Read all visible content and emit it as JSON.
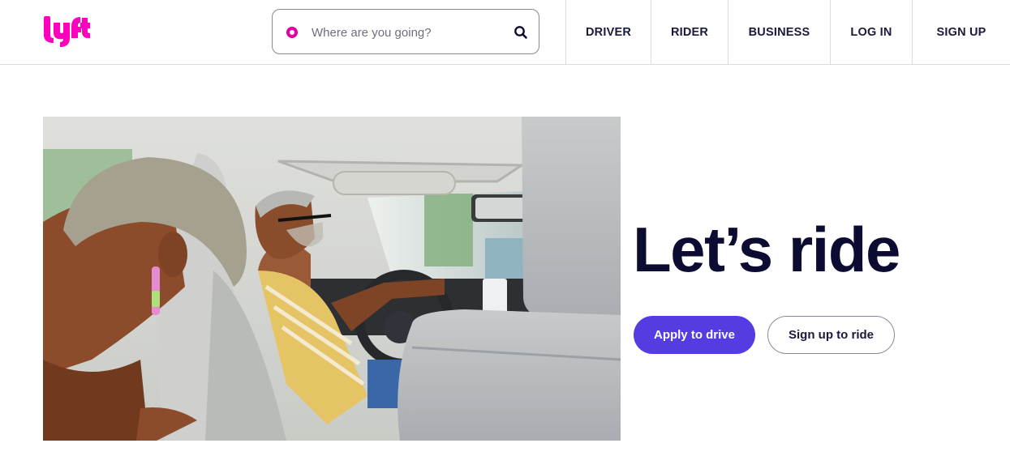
{
  "brand": {
    "logo_text": "lyft",
    "logo_color": "#ff00bf"
  },
  "search": {
    "placeholder": "Where are you going?",
    "value": "",
    "pin_icon": "location-pin-icon",
    "search_icon": "search-icon",
    "pin_color": "#e500a4"
  },
  "nav": {
    "items": [
      {
        "label": "DRIVER"
      },
      {
        "label": "RIDER"
      },
      {
        "label": "BUSINESS"
      },
      {
        "label": "LOG IN"
      },
      {
        "label": "SIGN UP"
      }
    ]
  },
  "hero": {
    "image_alt": "Smiling driver at the wheel with a laughing passenger in the back seat",
    "title": "Let’s ride",
    "primary_button": "Apply to drive",
    "secondary_button": "Sign up to ride",
    "accent_color": "#543ce3",
    "title_color": "#0c0b31"
  }
}
